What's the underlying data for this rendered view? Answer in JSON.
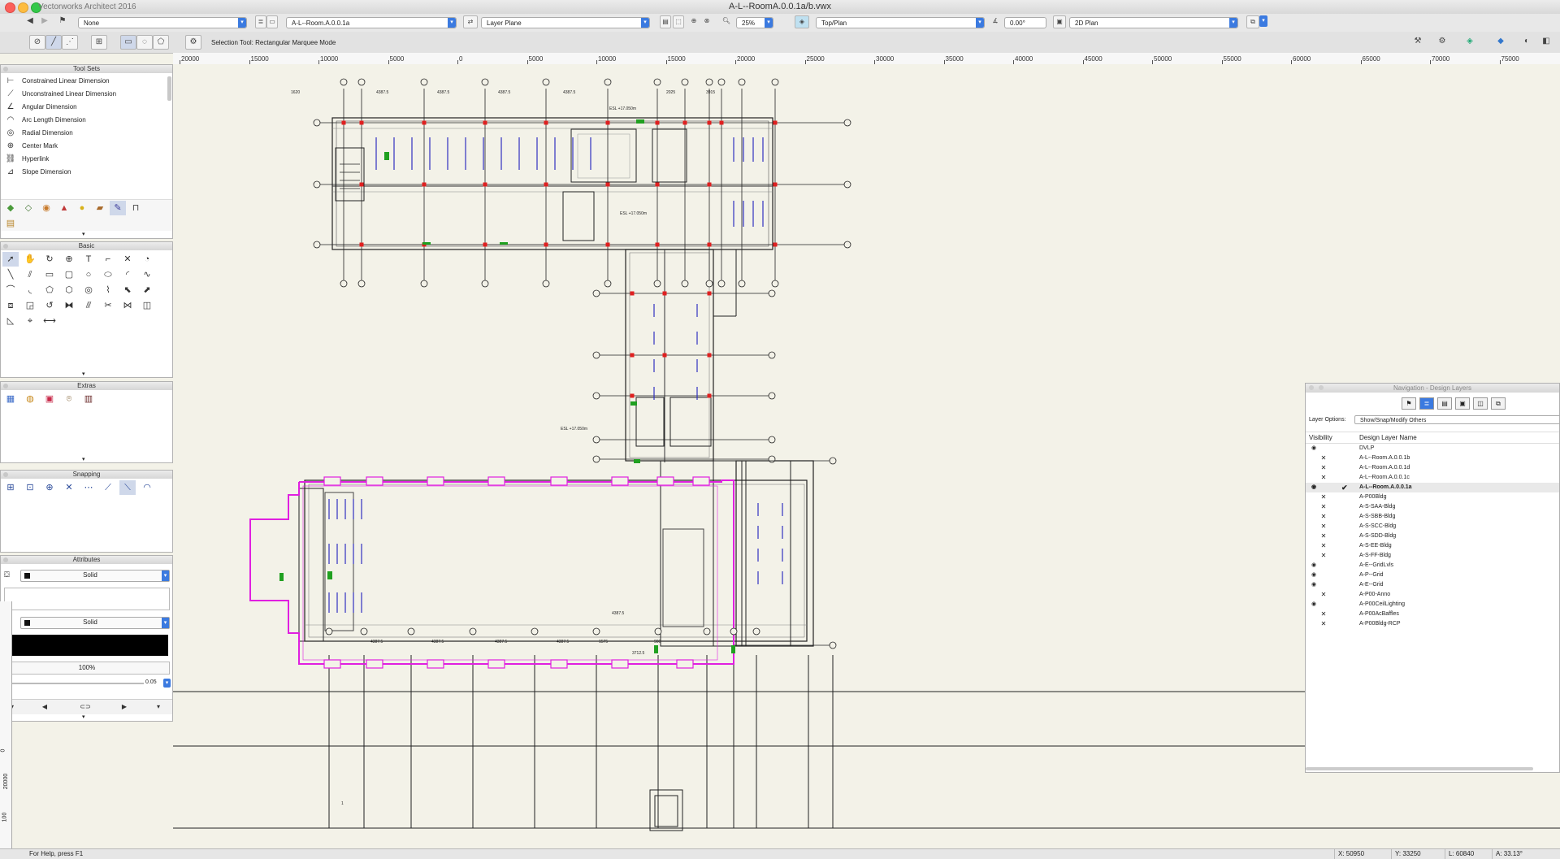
{
  "window": {
    "app_name": "Vectorworks Architect 2016",
    "document_title": "A-L--RoomA.0.0.1a/b.vwx"
  },
  "toolbar": {
    "class": "None",
    "layer": "A-L--Room.A.0.0.1a",
    "layer_plane": "Layer Plane",
    "zoom": "25%",
    "view": "Top/Plan",
    "rotation": "0.00°",
    "render_mode": "2D Plan",
    "mode_text": "Selection Tool: Rectangular Marquee Mode"
  },
  "tool_sets": {
    "title": "Tool Sets",
    "items": [
      {
        "icon": "constrained-linear-dimension-icon",
        "label": "Constrained Linear Dimension"
      },
      {
        "icon": "unconstrained-linear-dimension-icon",
        "label": "Unconstrained Linear Dimension"
      },
      {
        "icon": "angular-dimension-icon",
        "label": "Angular Dimension"
      },
      {
        "icon": "arc-length-dimension-icon",
        "label": "Arc Length Dimension"
      },
      {
        "icon": "radial-dimension-icon",
        "label": "Radial Dimension"
      },
      {
        "icon": "center-mark-icon",
        "label": "Center Mark"
      },
      {
        "icon": "hyperlink-icon",
        "label": "Hyperlink"
      },
      {
        "icon": "slope-dimension-icon",
        "label": "Slope Dimension"
      }
    ]
  },
  "basic": {
    "title": "Basic"
  },
  "extras": {
    "title": "Extras"
  },
  "snapping": {
    "title": "Snapping"
  },
  "attributes": {
    "title": "Attributes",
    "fill_style": "Solid",
    "pen_style": "Solid",
    "opacity": "100%",
    "line_thickness": "0.05"
  },
  "ruler": {
    "labels": [
      "20000",
      "15000",
      "10000",
      "5000",
      "0",
      "5000",
      "10000",
      "15000",
      "20000",
      "25000",
      "30000",
      "35000",
      "40000",
      "45000",
      "50000",
      "55000",
      "60000",
      "65000",
      "70000",
      "75000"
    ],
    "vertical_labels": [
      "0",
      "20000",
      "100"
    ]
  },
  "drawing": {
    "dimensions": [
      "4387.5",
      "4387.5",
      "4387.5",
      "4387.5",
      "4387.5",
      "1575",
      "900",
      "3712.5",
      "2025",
      "1620",
      "3915"
    ],
    "levels": [
      "ESL +17.050m",
      "ESL +17.050m",
      "ESL +17.050m"
    ],
    "colors": {
      "walls": "#333333",
      "highlight": "#e020e0",
      "columns": "#e02020",
      "fixtures": "#3030c0",
      "doors": "#20a020"
    }
  },
  "navigation": {
    "title": "Navigation - Design Layers",
    "layer_options_label": "Layer Options:",
    "layer_options_value": "Show/Snap/Modify Others",
    "col_visibility": "Visibility",
    "col_name": "Design Layer Name",
    "layers": [
      {
        "name": "DVLP",
        "vis": "eye",
        "active": false
      },
      {
        "name": "A-L--Room.A.0.0.1b",
        "vis": "x",
        "active": false
      },
      {
        "name": "A-L--Room.A.0.0.1d",
        "vis": "x",
        "active": false
      },
      {
        "name": "A-L--Room.A.0.0.1c",
        "vis": "x",
        "active": false
      },
      {
        "name": "A-L--Room.A.0.0.1a",
        "vis": "eye",
        "active": true
      },
      {
        "name": "A-P00Bldg",
        "vis": "x",
        "active": false
      },
      {
        "name": "A-S-SAA-Bldg",
        "vis": "x",
        "active": false
      },
      {
        "name": "A-S-SBB-Bldg",
        "vis": "x",
        "active": false
      },
      {
        "name": "A-S-SCC-Bldg",
        "vis": "x",
        "active": false
      },
      {
        "name": "A-S-SDD-Bldg",
        "vis": "x",
        "active": false
      },
      {
        "name": "A-S-EE-Bldg",
        "vis": "x",
        "active": false
      },
      {
        "name": "A-S-FF-Bldg",
        "vis": "x",
        "active": false
      },
      {
        "name": "A-E--GridLvls",
        "vis": "eye",
        "active": false
      },
      {
        "name": "A-P--Grid",
        "vis": "eye",
        "active": false
      },
      {
        "name": "A-E--Grid",
        "vis": "eye",
        "active": false
      },
      {
        "name": "A-P00-Anno",
        "vis": "x",
        "active": false
      },
      {
        "name": "A-P00CeilLighting",
        "vis": "eye",
        "active": false
      },
      {
        "name": "A-P00AcBaffles",
        "vis": "x",
        "active": false
      },
      {
        "name": "A-P00Bldg-RCP",
        "vis": "x",
        "active": false
      }
    ]
  },
  "status": {
    "help": "For Help, press F1",
    "x": "X: 50950",
    "y": "Y: 33250",
    "l": "L: 60840",
    "a": "A: 33.13°"
  }
}
